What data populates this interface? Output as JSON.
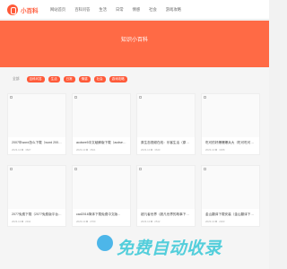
{
  "header": {
    "brand": "小百科",
    "nav": [
      "网站首页",
      "百科问答",
      "生活",
      "日常",
      "情感",
      "社会",
      "游戏攻略"
    ]
  },
  "banner": {
    "title": "知识小百科"
  },
  "filter": {
    "label": "全部",
    "tags": [
      "百科问答",
      "生活",
      "日常",
      "情感",
      "社会",
      "游戏攻略"
    ]
  },
  "cards": [
    {
      "title": "2007年word怎么下载（word 2007...",
      "meta_date": "2023-10",
      "meta_views": "3827"
    },
    {
      "title": "acdsee5中文破解版下载（acdsee...",
      "meta_date": "2023-10",
      "meta_views": "3521"
    },
    {
      "title": "原生态视频在线：乐客生活（原生态视频...",
      "meta_date": "2023-10",
      "meta_views": "3640"
    },
    {
      "title": "吃可的好爆爆爆兵大（吃可吃可爆兵什么最...",
      "meta_date": "2023-10",
      "meta_views": "3308"
    },
    {
      "title": "2077免费下载（2077免费版平台盒子）",
      "meta_date": "2023-10",
      "meta_views": "2911"
    },
    {
      "title": "cad2016简体下载免费中文版...",
      "meta_date": "2023-10",
      "meta_views": "2760"
    },
    {
      "title": "超凡者世界（超凡世界的故事下载）",
      "meta_date": "2023-10",
      "meta_views": "2512"
    },
    {
      "title": "金山翻译下载安装（金山翻译下载官网...",
      "meta_date": "2023-10",
      "meta_views": "2403"
    }
  ],
  "watermark": {
    "text": "免费自动收录"
  }
}
